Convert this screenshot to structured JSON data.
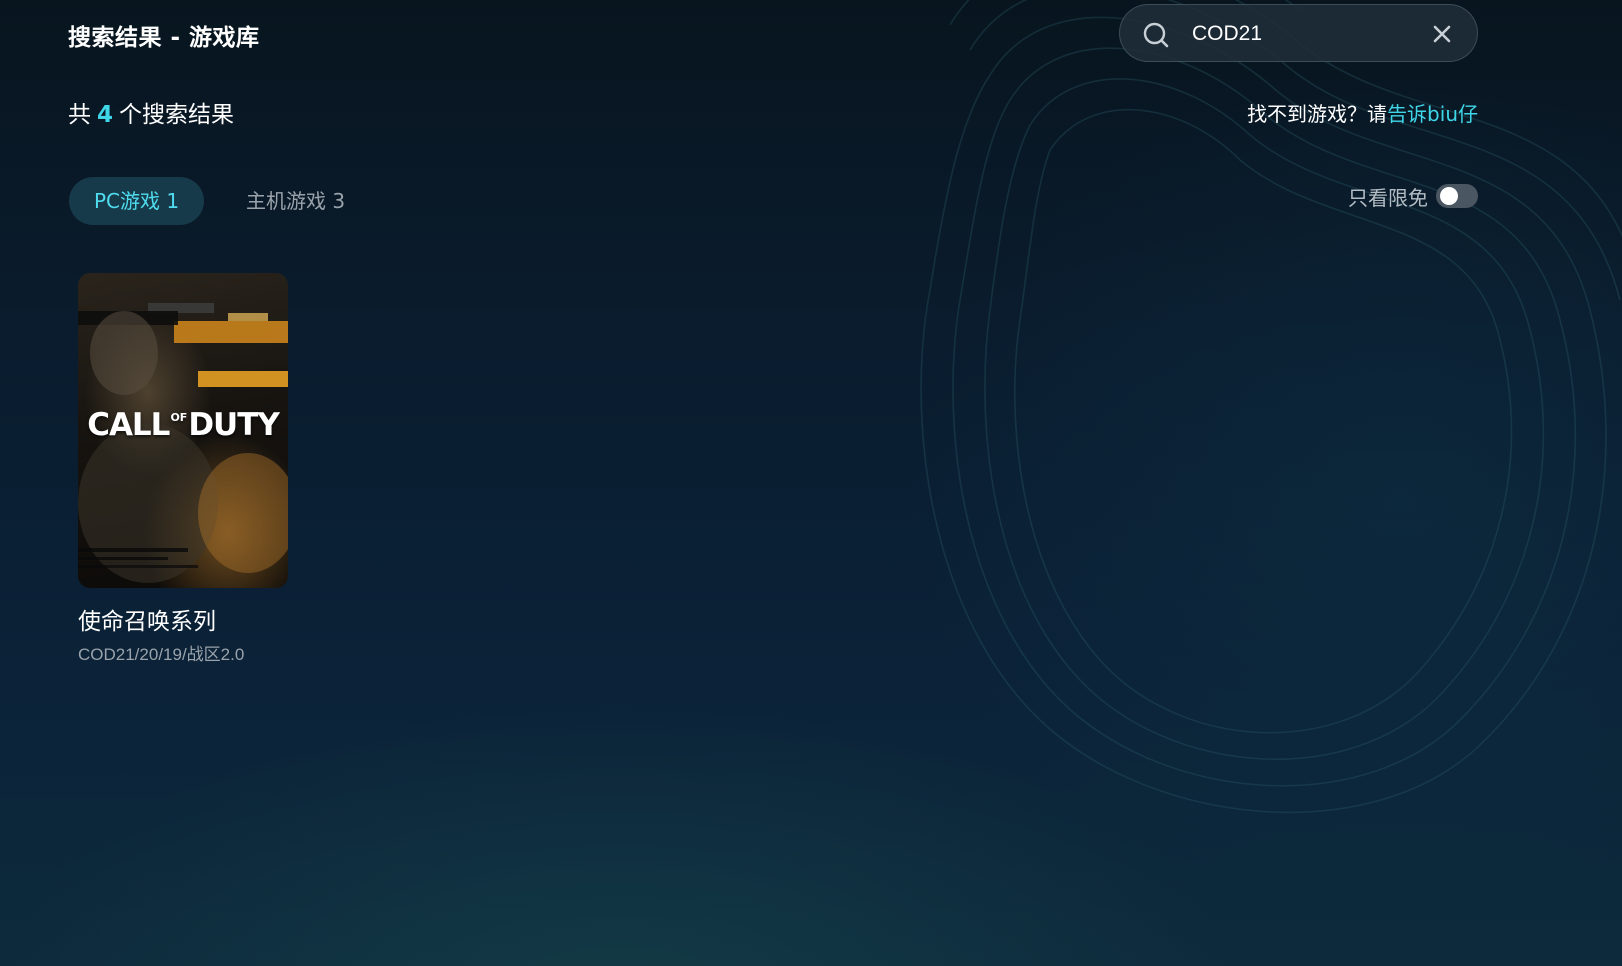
{
  "header": {
    "title": "搜索结果 - 游戏库"
  },
  "search": {
    "value": "COD21",
    "icon": "search-icon",
    "clear_icon": "close-icon"
  },
  "results": {
    "prefix": "共",
    "count": "4",
    "suffix": "个搜索结果"
  },
  "feedback": {
    "text": "找不到游戏？请",
    "link": "告诉biu仔"
  },
  "tabs": [
    {
      "label": "PC游戏 1",
      "active": true
    },
    {
      "label": "主机游戏 3",
      "active": false
    }
  ],
  "filter": {
    "label": "只看限免",
    "enabled": false
  },
  "games": [
    {
      "cover_text_1": "CALL",
      "cover_text_2": "OF",
      "cover_text_3": "DUTY",
      "name": "使命召唤系列",
      "subtitle": "COD21/20/19/战区2.0"
    }
  ],
  "colors": {
    "accent": "#3fd6e8",
    "background": "#0a1c2e",
    "tab_active_bg": "#173a4a"
  }
}
